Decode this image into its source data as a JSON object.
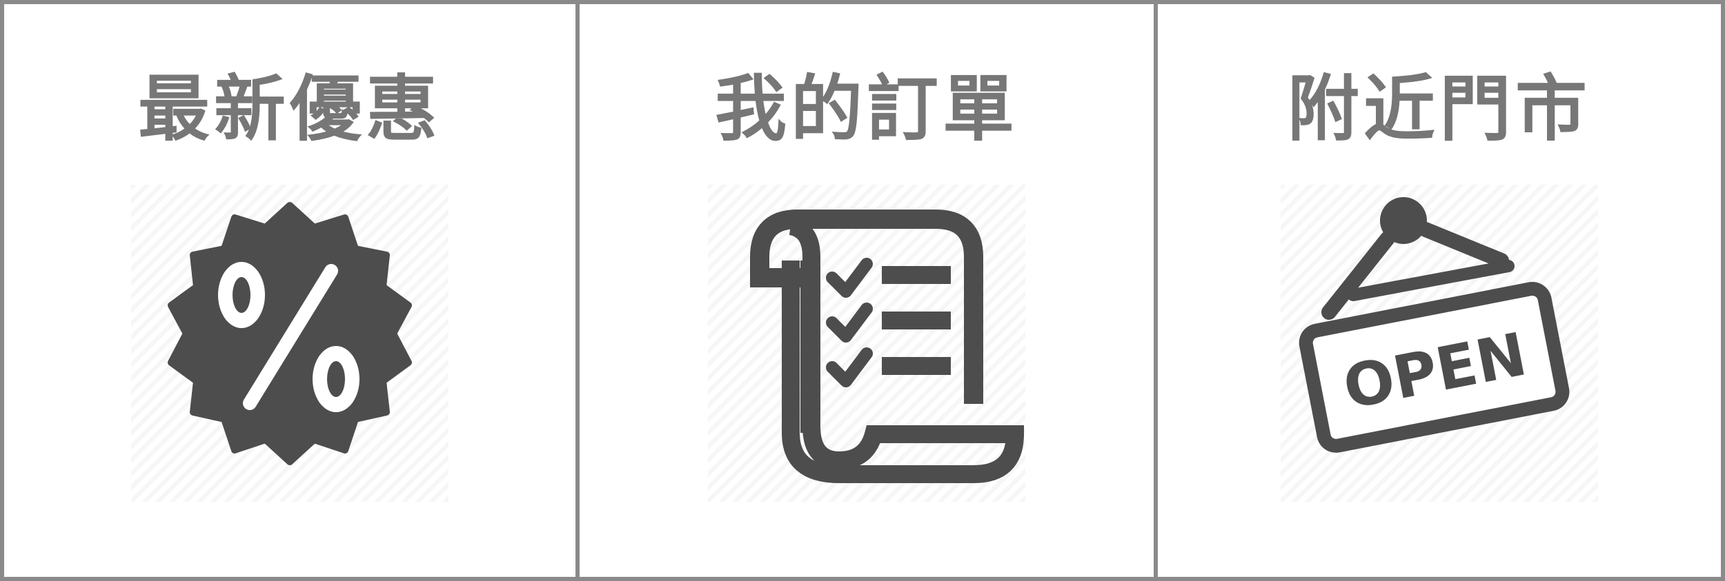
{
  "menu": {
    "items": [
      {
        "label": "最新優惠",
        "icon": "discount-badge-icon"
      },
      {
        "label": "我的訂單",
        "icon": "order-checklist-icon"
      },
      {
        "label": "附近門市",
        "icon": "open-sign-icon"
      }
    ]
  },
  "sign": {
    "text": "OPEN"
  },
  "colors": {
    "border": "#8a8a8a",
    "title": "#777777",
    "icon": "#4d4d4d",
    "background": "#ffffff"
  }
}
